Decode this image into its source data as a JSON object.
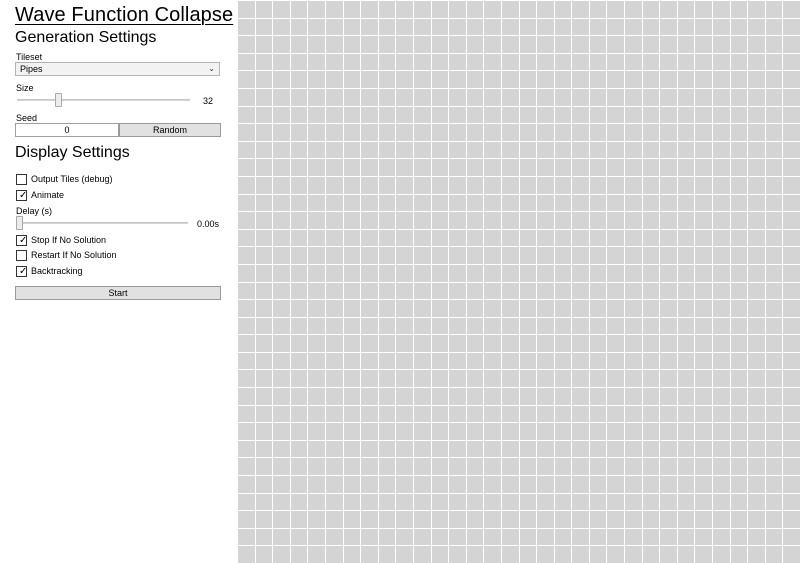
{
  "app": {
    "title": "Wave Function Collapse"
  },
  "generation": {
    "heading": "Generation Settings",
    "tileset": {
      "label": "Tileset",
      "value": "Pipes"
    },
    "size": {
      "label": "Size",
      "value": "32",
      "fraction": 0.23
    },
    "seed": {
      "label": "Seed",
      "value": "0",
      "random_label": "Random"
    }
  },
  "display": {
    "heading": "Display Settings",
    "output_tiles": {
      "label": "Output Tiles (debug)",
      "checked": false
    },
    "animate": {
      "label": "Animate",
      "checked": true
    },
    "delay": {
      "label": "Delay (s)",
      "value": "0.00s",
      "fraction": 0.0
    },
    "stop_if_no_solution": {
      "label": "Stop If No Solution",
      "checked": true
    },
    "restart_if_no_solution": {
      "label": "Restart If No Solution",
      "checked": false
    },
    "backtracking": {
      "label": "Backtracking",
      "checked": true
    }
  },
  "actions": {
    "start_label": "Start"
  },
  "grid": {
    "columns": 32,
    "rows": 32,
    "cell_color": "#d4d4d4",
    "line_color": "#ffffff"
  }
}
